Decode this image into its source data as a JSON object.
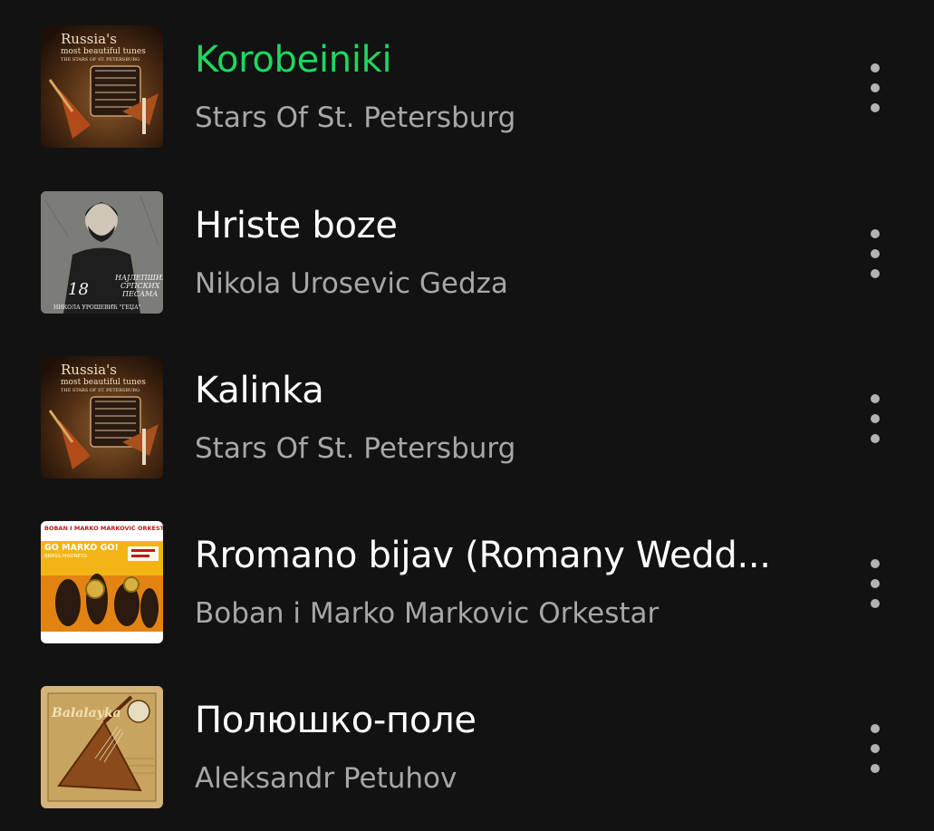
{
  "tracks": [
    {
      "title": "Korobeiniki",
      "artist": "Stars Of St. Petersburg",
      "active": true,
      "cover": {
        "art": "russia-album",
        "line1": "Russia's",
        "line2": "most beautiful tunes",
        "line3": "THE STARS OF ST. PETERSBURG"
      }
    },
    {
      "title": "Hriste boze",
      "artist": "Nikola Urosevic Gedza",
      "active": false,
      "cover": {
        "art": "serbian-album",
        "number": "18",
        "line1": "НАЈЛЕПШИХ",
        "line2": "СРПСКИХ",
        "line3": "ПЕСАМА",
        "line4": "НИКОЛА УРОШЕВИЋ \"ГЕЏА\""
      }
    },
    {
      "title": "Kalinka",
      "artist": "Stars Of St. Petersburg",
      "active": false,
      "cover": {
        "art": "russia-album",
        "line1": "Russia's",
        "line2": "most beautiful tunes",
        "line3": "THE STARS OF ST. PETERSBURG"
      }
    },
    {
      "title": "Rromano bijav (Romany Wedd...",
      "artist": "Boban i Marko Markovic Orkestar",
      "active": false,
      "cover": {
        "art": "brass-album",
        "line1": "BOBAN I MARKO MARKOVIĆ ORKESTAR",
        "line2": "GO MARKO GO!",
        "line3": "BRASS MADNESS"
      }
    },
    {
      "title": "Полюшко-поле",
      "artist": "Aleksandr Petuhov",
      "active": false,
      "cover": {
        "art": "balalayka-album",
        "line1": "Balalayka"
      }
    }
  ],
  "colors": {
    "background": "#121212",
    "active_title": "#1ed760",
    "title": "#ffffff",
    "artist": "#a7a7a7",
    "more_dots": "#b3b3b3"
  },
  "icons": {
    "more": "more-vertical-icon"
  }
}
